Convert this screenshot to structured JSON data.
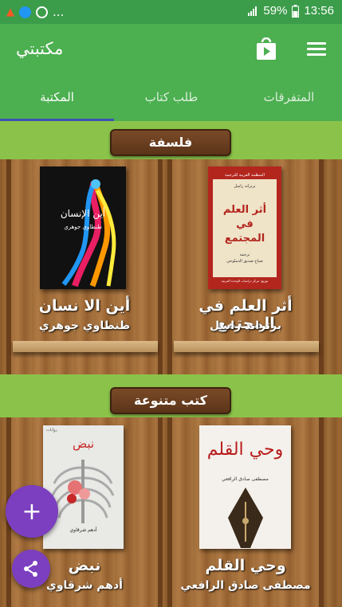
{
  "status_bar": {
    "battery": "59%",
    "time": "13:56",
    "dots": "..."
  },
  "app_bar": {
    "title": "مكتبتي"
  },
  "tabs": [
    {
      "label": "المتفرقات",
      "selected": false
    },
    {
      "label": "طلب كتاب",
      "selected": false
    },
    {
      "label": "المكتبة",
      "selected": true
    }
  ],
  "sections": [
    {
      "title": "فلسفة",
      "books": [
        {
          "title": "أثر العلم في المجتمع",
          "author": "برتراند راسل",
          "cover": {
            "top": "المنظمة العربية للترجمة",
            "author": "برتراند راسل",
            "title": "أثر العلم في المجتمع",
            "translator_label": "ترجمة",
            "translator": "صباح صديق الدملوجي",
            "bottom": "توزيع: مركز دراسات الوحدة العربية"
          }
        },
        {
          "title": "أين الا نسان",
          "author": "طنطاوي جوهري",
          "cover": {
            "title": "أين الإنسان",
            "author": "طنطاوي جوهري"
          }
        }
      ]
    },
    {
      "title": "كتب متنوعة",
      "books": [
        {
          "title": "وحي القلم",
          "author": "مصطفى صادق الرافعي",
          "cover": {
            "title": "وحي القلم",
            "author": "مصطفى صادق الرافعي"
          }
        },
        {
          "title": "نبض",
          "author": "أدهم شرقاوي",
          "cover": {
            "title": "نبض",
            "author": "أدهم شرقاوي",
            "corner": "روايات"
          }
        }
      ]
    }
  ],
  "fab_add": {
    "label": "+"
  },
  "colors": {
    "primary": "#4caf50",
    "status": "#3b9c4a",
    "accent": "#7b3fbf",
    "indicator": "#3f51b5"
  }
}
